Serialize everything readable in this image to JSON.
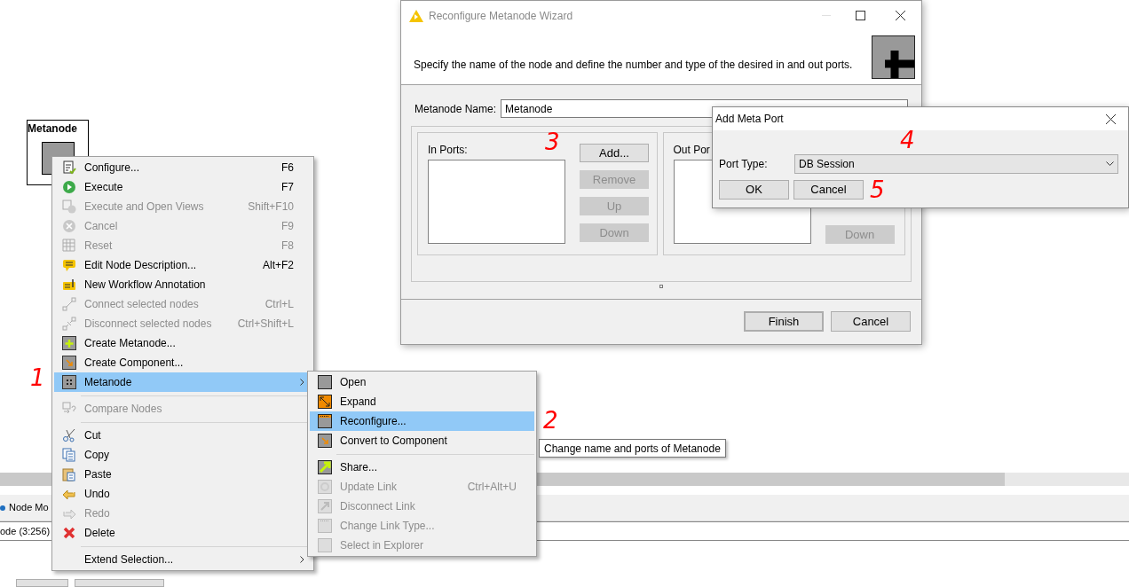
{
  "canvas": {
    "node": {
      "label": "Metanode"
    }
  },
  "bottom_panel": {
    "tab": "Node Mo",
    "status": "ode (3:256)"
  },
  "context_menu": {
    "items": [
      {
        "label": "Configure...",
        "shortcut": "F6",
        "disabled": false,
        "selected": false,
        "submenu": false,
        "separator_after": false
      },
      {
        "label": "Execute",
        "shortcut": "F7",
        "disabled": false,
        "selected": false,
        "submenu": false,
        "separator_after": false
      },
      {
        "label": "Execute and Open Views",
        "shortcut": "Shift+F10",
        "disabled": true,
        "selected": false,
        "submenu": false,
        "separator_after": false
      },
      {
        "label": "Cancel",
        "shortcut": "F9",
        "disabled": true,
        "selected": false,
        "submenu": false,
        "separator_after": false
      },
      {
        "label": "Reset",
        "shortcut": "F8",
        "disabled": true,
        "selected": false,
        "submenu": false,
        "separator_after": false
      },
      {
        "label": "Edit Node Description...",
        "shortcut": "Alt+F2",
        "disabled": false,
        "selected": false,
        "submenu": false,
        "separator_after": false
      },
      {
        "label": "New Workflow Annotation",
        "disabled": false,
        "selected": false,
        "submenu": false,
        "separator_after": false
      },
      {
        "label": "Connect selected nodes",
        "shortcut": "Ctrl+L",
        "disabled": true,
        "selected": false,
        "submenu": false,
        "separator_after": false
      },
      {
        "label": "Disconnect selected nodes",
        "shortcut": "Ctrl+Shift+L",
        "disabled": true,
        "selected": false,
        "submenu": false,
        "separator_after": false
      },
      {
        "label": "Create Metanode...",
        "disabled": false,
        "selected": false,
        "submenu": false,
        "separator_after": false
      },
      {
        "label": "Create Component...",
        "disabled": false,
        "selected": false,
        "submenu": false,
        "separator_after": false
      },
      {
        "label": "Metanode",
        "disabled": false,
        "selected": true,
        "submenu": true,
        "separator_after": true
      },
      {
        "label": "Compare Nodes",
        "disabled": true,
        "selected": false,
        "submenu": false,
        "separator_after": true
      },
      {
        "label": "Cut",
        "disabled": false,
        "selected": false,
        "submenu": false,
        "separator_after": false
      },
      {
        "label": "Copy",
        "disabled": false,
        "selected": false,
        "submenu": false,
        "separator_after": false
      },
      {
        "label": "Paste",
        "disabled": false,
        "selected": false,
        "submenu": false,
        "separator_after": false
      },
      {
        "label": "Undo",
        "disabled": false,
        "selected": false,
        "submenu": false,
        "separator_after": false
      },
      {
        "label": "Redo",
        "disabled": true,
        "selected": false,
        "submenu": false,
        "separator_after": false
      },
      {
        "label": "Delete",
        "disabled": false,
        "selected": false,
        "submenu": false,
        "separator_after": true
      },
      {
        "label": "Extend Selection...",
        "disabled": false,
        "selected": false,
        "submenu": true,
        "separator_after": false
      }
    ]
  },
  "submenu": {
    "items": [
      {
        "label": "Open",
        "disabled": false,
        "selected": false,
        "separator_after": false
      },
      {
        "label": "Expand",
        "disabled": false,
        "selected": false,
        "separator_after": false
      },
      {
        "label": "Reconfigure...",
        "disabled": false,
        "selected": true,
        "separator_after": false
      },
      {
        "label": "Convert to Component",
        "disabled": false,
        "selected": false,
        "separator_after": true
      },
      {
        "label": "Share...",
        "disabled": false,
        "selected": false,
        "separator_after": false
      },
      {
        "label": "Update Link",
        "shortcut": "Ctrl+Alt+U",
        "disabled": true,
        "selected": false,
        "separator_after": false
      },
      {
        "label": "Disconnect Link",
        "disabled": true,
        "selected": false,
        "separator_after": false
      },
      {
        "label": "Change Link Type...",
        "disabled": true,
        "selected": false,
        "separator_after": false
      },
      {
        "label": "Select in Explorer",
        "disabled": true,
        "selected": false,
        "separator_after": false
      }
    ]
  },
  "tooltip": "Change name and ports of Metanode",
  "wizard": {
    "title": "Reconfigure Metanode Wizard",
    "description": "Specify the name of the node and define the number and type of the desired in and out ports.",
    "name_label": "Metanode Name:",
    "name_value": "Metanode",
    "in_ports": {
      "label": "In Ports:",
      "buttons": [
        {
          "label": "Add...",
          "disabled": false
        },
        {
          "label": "Remove",
          "disabled": true
        },
        {
          "label": "Up",
          "disabled": true
        },
        {
          "label": "Down",
          "disabled": true
        }
      ]
    },
    "out_ports": {
      "label": "Out Por",
      "buttons": [
        {
          "label": "Down",
          "disabled": true
        }
      ]
    },
    "buttons": [
      {
        "label": "Finish",
        "default": true
      },
      {
        "label": "Cancel",
        "default": false
      }
    ]
  },
  "add_port_dialog": {
    "title": "Add Meta Port",
    "port_type_label": "Port Type:",
    "port_type_value": "DB Session",
    "buttons": [
      "OK",
      "Cancel"
    ]
  },
  "annotations": [
    "1",
    "2",
    "3",
    "4",
    "5"
  ]
}
